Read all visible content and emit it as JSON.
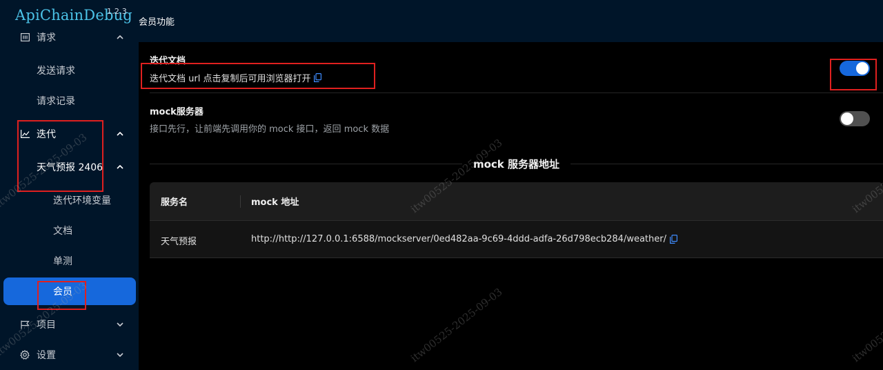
{
  "app": {
    "logo": "ApiChainDebug",
    "version": "1.2.3"
  },
  "sidebar": {
    "items": [
      {
        "label": "请求",
        "icon": "request-icon",
        "expanded": true
      },
      {
        "label": "发送请求"
      },
      {
        "label": "请求记录"
      },
      {
        "label": "迭代",
        "icon": "chart-icon",
        "expanded": true
      },
      {
        "label": "天气预报 2406",
        "expanded": true
      },
      {
        "label": "迭代环境变量"
      },
      {
        "label": "文档"
      },
      {
        "label": "单测"
      },
      {
        "label": "会员",
        "selected": true
      },
      {
        "label": "项目",
        "icon": "flag-icon",
        "expanded": false
      },
      {
        "label": "设置",
        "icon": "gear-icon",
        "expanded": false
      }
    ]
  },
  "header": {
    "breadcrumb": "会员功能"
  },
  "settings": {
    "doc": {
      "title": "迭代文档",
      "description": "迭代文档 url 点击复制后可用浏览器打开",
      "enabled": true
    },
    "mock": {
      "title": "mock服务器",
      "description": "接口先行，让前端先调用你的 mock 接口，返回 mock 数据",
      "enabled": false
    }
  },
  "mock_section": {
    "title": "mock 服务器地址"
  },
  "table": {
    "columns": [
      "服务名",
      "mock 地址"
    ],
    "rows": [
      {
        "name": "天气预报",
        "url": "http://http://127.0.0.1:6588/mockserver/0ed482aa-9c69-4ddd-adfa-26d798ecb284/weather/"
      }
    ]
  },
  "watermark": "itw00525-2025-09-03",
  "colors": {
    "sidebar_bg": "#001529",
    "accent": "#1668dc",
    "annotation": "#e0201f",
    "logo": "#4cc3e8"
  }
}
